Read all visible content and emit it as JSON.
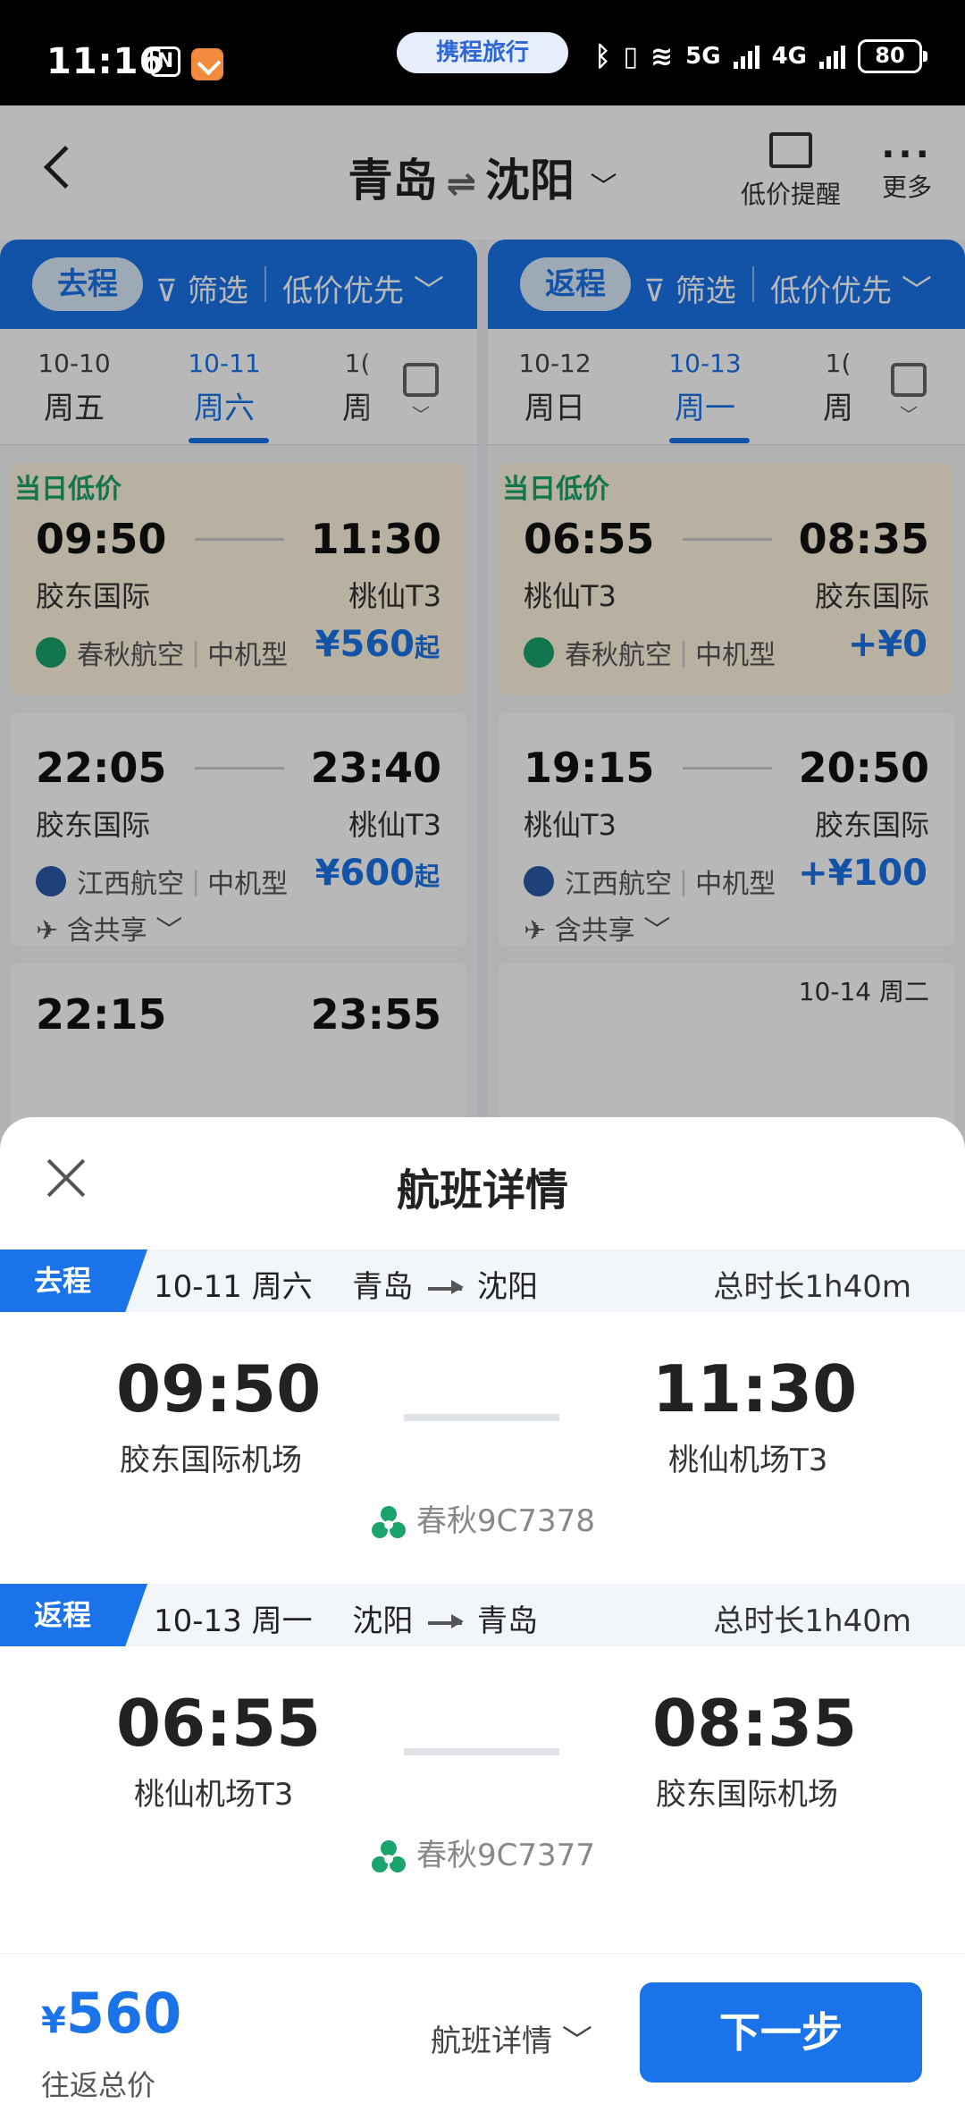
{
  "status_bar": {
    "time": "11:16",
    "center_pill": "携程旅行",
    "network": "5G",
    "network2": "4G",
    "battery": "80"
  },
  "header": {
    "origin": "青岛",
    "destination": "沈阳",
    "low_price_alert": "低价提醒",
    "more": "更多"
  },
  "outbound_panel": {
    "trip_label": "去程",
    "filter_label": "筛选",
    "sort_label": "低价优先",
    "dates": [
      {
        "date": "10-10",
        "weekday": "周五"
      },
      {
        "date": "10-11",
        "weekday": "周六"
      },
      {
        "date": "1(",
        "weekday": "周"
      }
    ],
    "flights": [
      {
        "tag": "当日低价",
        "dep": "09:50",
        "arr": "11:30",
        "dep_ap": "胶东国际",
        "arr_ap": "桃仙T3",
        "airline": "春秋航空",
        "plane": "中机型",
        "price": "¥560",
        "price_suffix": "起"
      },
      {
        "dep": "22:05",
        "arr": "23:40",
        "dep_ap": "胶东国际",
        "arr_ap": "桃仙T3",
        "airline": "江西航空",
        "plane": "中机型",
        "price": "¥600",
        "price_suffix": "起",
        "share": "含共享"
      },
      {
        "dep": "22:15",
        "arr": "23:55"
      }
    ]
  },
  "return_panel": {
    "trip_label": "返程",
    "filter_label": "筛选",
    "sort_label": "低价优先",
    "dates": [
      {
        "date": "10-12",
        "weekday": "周日"
      },
      {
        "date": "10-13",
        "weekday": "周一"
      },
      {
        "date": "1(",
        "weekday": "周"
      }
    ],
    "flights": [
      {
        "tag": "当日低价",
        "dep": "06:55",
        "arr": "08:35",
        "dep_ap": "桃仙T3",
        "arr_ap": "胶东国际",
        "airline": "春秋航空",
        "plane": "中机型",
        "price": "+¥0"
      },
      {
        "dep": "19:15",
        "arr": "20:50",
        "dep_ap": "桃仙T3",
        "arr_ap": "胶东国际",
        "airline": "江西航空",
        "plane": "中机型",
        "price": "+¥100",
        "share": "含共享"
      },
      {
        "next_day": "10-14 周二"
      }
    ]
  },
  "sheet": {
    "title": "航班详情",
    "segments": [
      {
        "tag": "去程",
        "date": "10-11 周六",
        "from": "青岛",
        "to": "沈阳",
        "duration": "总时长1h40m",
        "dep": "09:50",
        "arr": "11:30",
        "dep_ap": "胶东国际机场",
        "arr_ap": "桃仙机场T3",
        "flight": "春秋9C7378"
      },
      {
        "tag": "返程",
        "date": "10-13 周一",
        "from": "沈阳",
        "to": "青岛",
        "duration": "总时长1h40m",
        "dep": "06:55",
        "arr": "08:35",
        "dep_ap": "桃仙机场T3",
        "arr_ap": "胶东国际机场",
        "flight": "春秋9C7377"
      }
    ],
    "footer": {
      "currency": "¥",
      "price": "560",
      "price_label": "往返总价",
      "detail_link": "航班详情",
      "next_button": "下一步"
    }
  },
  "colors": {
    "accent": "#1a73e8",
    "spring_green": "#1aa36b",
    "low_price_bg": "#fff6df"
  },
  "icons": [
    "back-icon",
    "swap-icon",
    "chart-alert-icon",
    "more-icon",
    "filter-icon",
    "calendar-icon",
    "close-icon",
    "spring-airlines-icon",
    "jiangxi-airlines-icon",
    "share-plane-icon",
    "chevron-down-icon"
  ]
}
